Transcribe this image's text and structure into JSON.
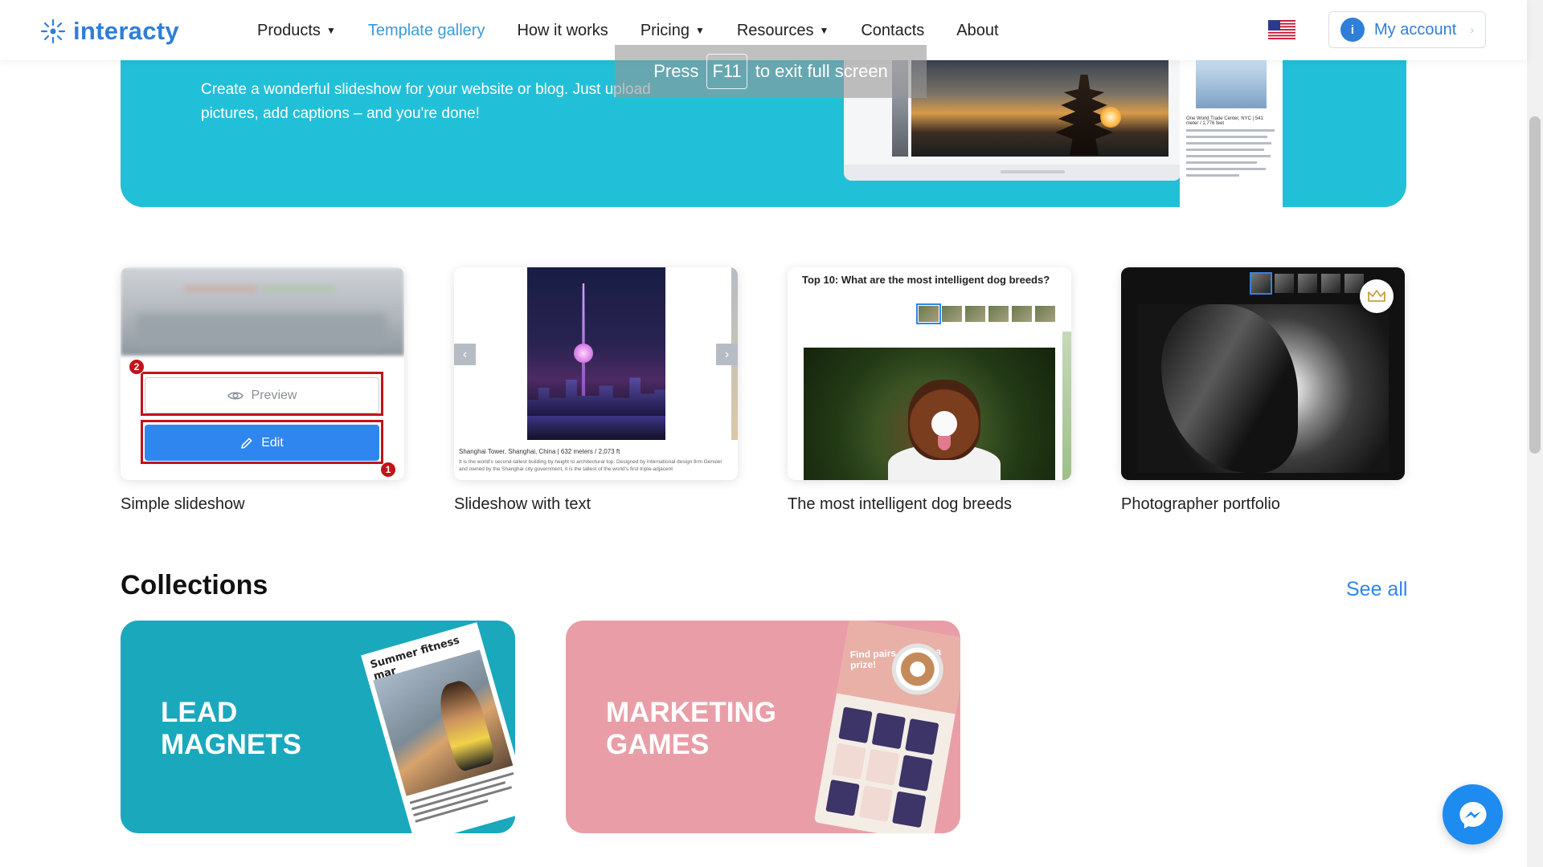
{
  "brand": {
    "name": "interacty",
    "accent": "#2f7ed8"
  },
  "nav": {
    "items": [
      {
        "label": "Products",
        "dropdown": true,
        "active": false
      },
      {
        "label": "Template gallery",
        "dropdown": false,
        "active": true
      },
      {
        "label": "How it works",
        "dropdown": false,
        "active": false
      },
      {
        "label": "Pricing",
        "dropdown": true,
        "active": false
      },
      {
        "label": "Resources",
        "dropdown": true,
        "active": false
      },
      {
        "label": "Contacts",
        "dropdown": false,
        "active": false
      },
      {
        "label": "About",
        "dropdown": false,
        "active": false
      }
    ],
    "flag_icon": "us-flag-icon",
    "account": {
      "avatar_letter": "i",
      "label": "My account"
    }
  },
  "fullscreen_toast": {
    "pre": "Press",
    "key": "F11",
    "post": "to exit full screen"
  },
  "hero": {
    "text": "Create a wonderful slideshow for your website or blog. Just upload pictures, add captions – and you're done!",
    "phone_caption": "One World Trade Center, NYC | 541 meter / 1,776 feet"
  },
  "templates": [
    {
      "caption": "Simple slideshow",
      "preview_label": "Preview",
      "edit_label": "Edit",
      "badge_preview": "2",
      "badge_edit": "1"
    },
    {
      "caption": "Slideshow with text",
      "slide_caption": "Shanghai Tower, Shanghai, China | 632 meters / 2,073 ft",
      "slide_desc": "It is the world's second-tallest building by height to architectural top. Designed by international design firm Gensler and owned by the Shanghai city government, it is the tallest of the world's first triple-adjacent"
    },
    {
      "caption": "The most intelligent dog breeds",
      "title": "Top 10: What are the most intelligent dog breeds?"
    },
    {
      "caption": "Photographer portfolio",
      "premium_icon": "crown-icon"
    }
  ],
  "collections": {
    "title": "Collections",
    "see_all": "See all",
    "items": [
      {
        "label": "LEAD\nMAGNETS",
        "color": "#1aa8bd",
        "magazine_title": "Summer fitness mar"
      },
      {
        "label": "MARKETING\nGAMES",
        "color": "#e99ea7",
        "slogan": "Find pairs and get a prize!"
      }
    ]
  },
  "messenger_icon": "messenger-icon"
}
